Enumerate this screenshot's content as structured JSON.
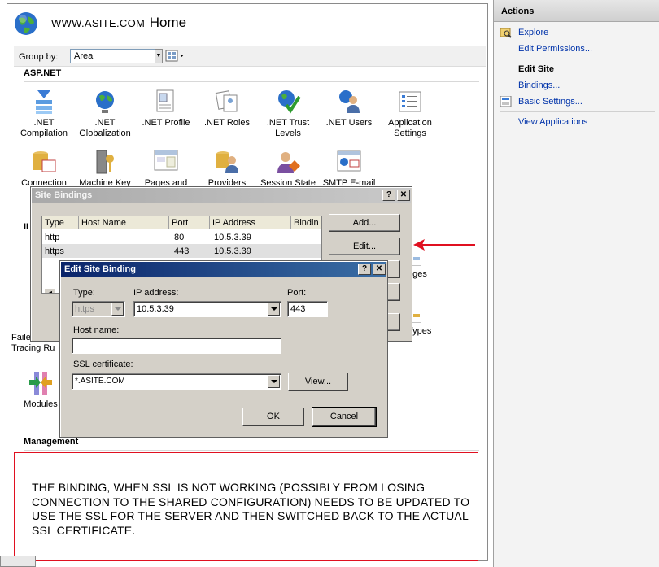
{
  "header": {
    "site": "WWW.ASITE.COM",
    "home": "Home"
  },
  "groupbar": {
    "label": "Group by:",
    "value": "Area"
  },
  "sections": {
    "aspnet": "ASP.NET",
    "iis": "II",
    "management": "Management"
  },
  "features": {
    "net_compilation": ".NET Compilation",
    "net_globalization": ".NET Globalization",
    "net_profile": ".NET Profile",
    "net_roles": ".NET Roles",
    "net_trust": ".NET Trust Levels",
    "net_users": ".NET Users",
    "app_settings": "Application Settings",
    "connection": "Connection",
    "machine_key": "Machine Key",
    "pages_and": "Pages and",
    "providers": "Providers",
    "session_state": "Session State",
    "smtp": "SMTP E-mail",
    "failed_1": "Faile",
    "failed_2": "Tracing Ru",
    "modules": "Modules",
    "ages": "ages",
    "types": "Types"
  },
  "actions": {
    "title": "Actions",
    "explore": "Explore",
    "edit_permissions": "Edit Permissions...",
    "edit_site": "Edit Site",
    "bindings": "Bindings...",
    "basic_settings": "Basic Settings...",
    "view_applications": "View Applications"
  },
  "site_bindings": {
    "title": "Site Bindings",
    "columns": [
      "Type",
      "Host Name",
      "Port",
      "IP Address",
      "Bindin"
    ],
    "rows": [
      {
        "type": "http",
        "host": "",
        "port": "80",
        "ip": "10.5.3.39"
      },
      {
        "type": "https",
        "host": "",
        "port": "443",
        "ip": "10.5.3.39"
      }
    ],
    "add": "Add...",
    "edit": "Edit..."
  },
  "edit_binding": {
    "title": "Edit Site Binding",
    "type_label": "Type:",
    "type_value": "https",
    "ip_label": "IP address:",
    "ip_value": "10.5.3.39",
    "port_label": "Port:",
    "port_value": "443",
    "host_label": "Host name:",
    "host_value": "",
    "ssl_label": "SSL certificate:",
    "ssl_value": "*.ASITE.COM",
    "view": "View...",
    "ok": "OK",
    "cancel": "Cancel"
  },
  "annotation": {
    "text": "THE BINDING, WHEN SSL IS NOT WORKING (POSSIBLY FROM LOSING CONNECTION TO THE SHARED CONFIGURATION) NEEDS TO BE UPDATED TO USE THE SSL FOR THE SERVER AND THEN SWITCHED BACK TO THE ACTUAL SSL CERTIFICATE."
  },
  "colors": {
    "annotation": "#e01020",
    "link": "#0033aa",
    "active_title": "#0a246a"
  },
  "icons": [
    "globe-icon",
    "help-icon",
    "close-icon",
    "explore-icon",
    "settings-icon",
    "arrow-icon"
  ]
}
